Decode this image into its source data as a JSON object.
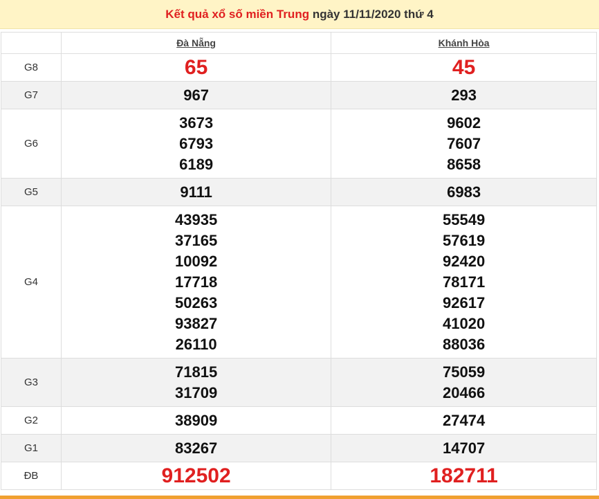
{
  "header": {
    "part1": "Kết quả xổ số miền Trung",
    "part2": "ngày 11/11/2020 thứ 4"
  },
  "columns": [
    "Đà Nẵng",
    "Khánh Hòa"
  ],
  "prizes": [
    {
      "label": "G8",
      "danang": [
        "65"
      ],
      "khanhhoa": [
        "45"
      ]
    },
    {
      "label": "G7",
      "danang": [
        "967"
      ],
      "khanhhoa": [
        "293"
      ]
    },
    {
      "label": "G6",
      "danang": [
        "3673",
        "6793",
        "6189"
      ],
      "khanhhoa": [
        "9602",
        "7607",
        "8658"
      ]
    },
    {
      "label": "G5",
      "danang": [
        "9111"
      ],
      "khanhhoa": [
        "6983"
      ]
    },
    {
      "label": "G4",
      "danang": [
        "43935",
        "37165",
        "10092",
        "17718",
        "50263",
        "93827",
        "26110"
      ],
      "khanhhoa": [
        "55549",
        "57619",
        "92420",
        "78171",
        "92617",
        "41020",
        "88036"
      ]
    },
    {
      "label": "G3",
      "danang": [
        "71815",
        "31709"
      ],
      "khanhhoa": [
        "75059",
        "20466"
      ]
    },
    {
      "label": "G2",
      "danang": [
        "38909"
      ],
      "khanhhoa": [
        "27474"
      ]
    },
    {
      "label": "G1",
      "danang": [
        "83267"
      ],
      "khanhhoa": [
        "14707"
      ]
    },
    {
      "label": "ĐB",
      "danang": [
        "912502"
      ],
      "khanhhoa": [
        "182711"
      ]
    }
  ],
  "colors": {
    "header_bg": "#fff4c6",
    "accent_red": "#e02020",
    "row_alt": "#f2f2f2",
    "bottom_bar": "#f0a030"
  }
}
